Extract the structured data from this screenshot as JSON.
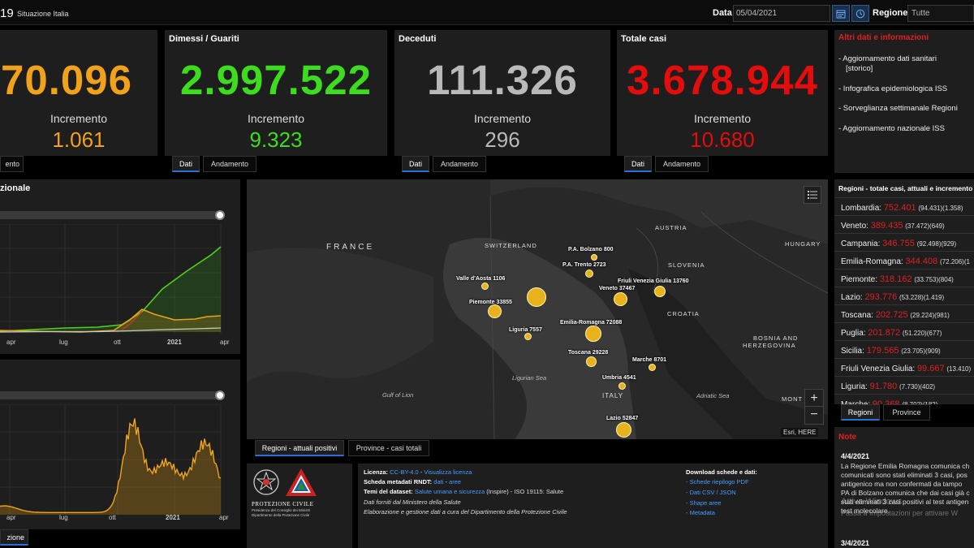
{
  "header": {
    "title": "19",
    "subtitle": "Situazione Italia",
    "date_label": "Data",
    "date_value": "05/04/2021",
    "region_label": "Regione",
    "region_value": "Tutte"
  },
  "kpis": {
    "positivi": {
      "value": "70.096",
      "inc_label": "Incremento",
      "inc_value": "1.061",
      "tab": "ento",
      "color": "#f2a21a"
    },
    "dimessi": {
      "title": "Dimessi / Guariti",
      "value": "2.997.522",
      "inc_label": "Incremento",
      "inc_value": "9.323",
      "color": "#3ddc1e"
    },
    "deceduti": {
      "title": "Deceduti",
      "value": "111.326",
      "inc_label": "Incremento",
      "inc_value": "296",
      "color": "#b9b9b9"
    },
    "totale": {
      "title": "Totale casi",
      "value": "3.678.944",
      "inc_label": "Incremento",
      "inc_value": "10.680",
      "color": "#e30d0d"
    }
  },
  "tabs": {
    "dati": "Dati",
    "andamento": "Andamento"
  },
  "info": {
    "title": "Altri dati e informazioni",
    "items": [
      "- Aggiornamento dati sanitari",
      "[storico]",
      "- Infografica epidemiologica ISS",
      "- Sorveglianza settimanale Regioni",
      "- Aggiornamento nazionale ISS"
    ]
  },
  "regions": {
    "title": "Regioni - totale casi, attuali e incremento",
    "rows": [
      {
        "name": "Lombardia:",
        "tot": "752.401",
        "att": "(94.431)",
        "inc": "(1.358)"
      },
      {
        "name": "Veneto:",
        "tot": "389.435",
        "att": "(37.472)",
        "inc": "(649)"
      },
      {
        "name": "Campania:",
        "tot": "346.755",
        "att": "(92.498)",
        "inc": "(929)"
      },
      {
        "name": "Emilia-Romagna:",
        "tot": "344.408",
        "att": "(72.206)",
        "inc": "(1"
      },
      {
        "name": "Piemonte:",
        "tot": "318.162",
        "att": "(33.753)",
        "inc": "(804)"
      },
      {
        "name": "Lazio:",
        "tot": "293.776",
        "att": "(53.228)",
        "inc": "(1.419)"
      },
      {
        "name": "Toscana:",
        "tot": "202.725",
        "att": "(29.224)",
        "inc": "(981)"
      },
      {
        "name": "Puglia:",
        "tot": "201.872",
        "att": "(51.220)",
        "inc": "(677)"
      },
      {
        "name": "Sicilia:",
        "tot": "179.565",
        "att": "(23.705)",
        "inc": "(909)"
      },
      {
        "name": "Friuli Venezia Giulia:",
        "tot": "99.667",
        "att": "(13.410)",
        "inc": ""
      },
      {
        "name": "Liguria:",
        "tot": "91.780",
        "att": "(7.730)",
        "inc": "(402)"
      },
      {
        "name": "Marche:",
        "tot": "90.368",
        "att": "(8.702)",
        "inc": "(182)"
      }
    ],
    "tab_regioni": "Regioni",
    "tab_province": "Province"
  },
  "notes": {
    "title": "Note",
    "date1": "4/4/2021",
    "text1": [
      "La Regione Emilia Romagna comunica ch",
      "comunicati sono stati eliminati 3 casi, pos",
      "antigenico ma non confermati da tampo",
      "PA di Bolzano comunica che dai casi già c",
      "stati eliminati 3 casi positivi al test antigen",
      "test molecolare."
    ],
    "date2": "3/4/2021",
    "watermark1": "Attiva Windows",
    "watermark2": "Passa a Impostazioni per attivare W"
  },
  "chart1": {
    "title": "zionale",
    "x_labels": [
      "apr",
      "lug",
      "ott",
      "2021",
      "apr"
    ]
  },
  "chart2": {
    "x_labels": [
      "apr",
      "lug",
      "ott",
      "2021",
      "apr"
    ],
    "tab": "zione"
  },
  "map": {
    "countries": [
      "FRANCE",
      "SWITZERLAND",
      "AUSTRIA",
      "HUNGARY",
      "SLOVENIA",
      "CROATIA",
      "BOSNIA AND",
      "HERZEGOVINA",
      "MONT",
      "ITALY"
    ],
    "seas": [
      "Ligurian Sea",
      "Gulf of Lion",
      "Adriatic Sea"
    ],
    "cities": [
      {
        "name": "P.A. Bolzano 800"
      },
      {
        "name": "P.A. Trento 2723"
      },
      {
        "name": "Friuli Venezia Giulia 13760"
      },
      {
        "name": "Veneto 37467"
      },
      {
        "name": "Valle d'Aosta 1106"
      },
      {
        "name": "Piemonte 33855"
      },
      {
        "name": "Emilia-Romagna 72088"
      },
      {
        "name": "Liguria 7557"
      },
      {
        "name": "Toscana 29228"
      },
      {
        "name": "Marche 8701"
      },
      {
        "name": "Umbria 4541"
      },
      {
        "name": "Lazio 52847"
      }
    ],
    "attribution": "Esri, HERE",
    "tab_regioni": "Regioni - attuali positivi",
    "tab_province": "Province - casi totali"
  },
  "footer": {
    "logo_text": "PROTEZIONE CIVILE",
    "logo_sub1": "Presidenza del Consiglio dei Ministri",
    "logo_sub2": "Dipartimento della Protezione Civile",
    "licenza_label": "Licenza:",
    "licenza_value": "CC-BY-4.0",
    "licenza_link": "Visualizza licenza",
    "scheda_label": "Scheda metadati RNDT:",
    "scheda_link1": "dati",
    "scheda_link2": "aree",
    "temi_label": "Temi del dataset:",
    "temi_value": "Salute umana e sicurezza",
    "temi_rest": "(Inspire) - ISO 19115: Salute",
    "line4": "Dati forniti dal Ministero della Salute",
    "line5": "Elaborazione e gestione dati a cura del Dipartimento della Protezione Civile",
    "download_title": "Download schede e dati:",
    "download_items": [
      "Schede riepilogo PDF",
      "Dati CSV / JSON",
      "Shape aree",
      "Metadata"
    ]
  }
}
